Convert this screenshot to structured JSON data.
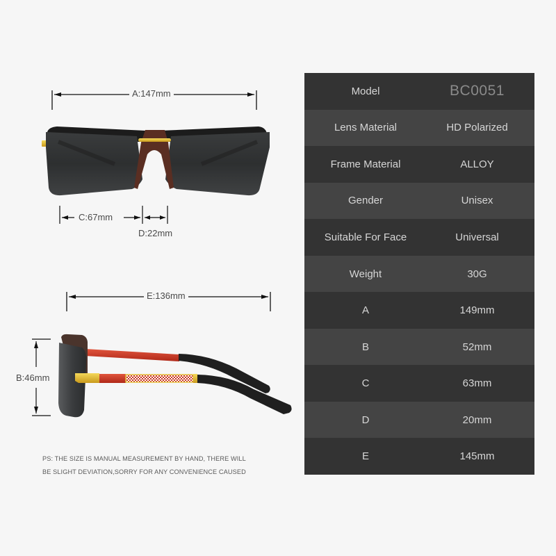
{
  "product": {
    "dimensions_front": {
      "a_label": "A:147mm",
      "c_label": "C:67mm",
      "d_label": "D:22mm"
    },
    "dimensions_side": {
      "e_label": "E:136mm",
      "b_label": "B:46mm"
    },
    "note_line1": "PS: THE SIZE IS MANUAL MEASUREMENT BY HAND, THERE WILL",
    "note_line2": "BE SLIGHT DEVIATION,SORRY FOR ANY CONVENIENCE CAUSED"
  },
  "colors": {
    "lens": "#2b2d2e",
    "bridge_brown": "#5a2e22",
    "gold": "#e8c23a",
    "temple_red": "#c8321f",
    "temple_tip": "#1f1f1f",
    "table_dark": "#333333",
    "table_light": "#444444"
  },
  "specs": [
    {
      "label": "Model",
      "value": "BC0051"
    },
    {
      "label": "Lens Material",
      "value": "HD Polarized"
    },
    {
      "label": "Frame Material",
      "value": "ALLOY"
    },
    {
      "label": "Gender",
      "value": "Unisex"
    },
    {
      "label": "Suitable For Face",
      "value": "Universal"
    },
    {
      "label": "Weight",
      "value": "30G"
    },
    {
      "label": "A",
      "value": "149mm"
    },
    {
      "label": "B",
      "value": "52mm"
    },
    {
      "label": "C",
      "value": "63mm"
    },
    {
      "label": "D",
      "value": "20mm"
    },
    {
      "label": "E",
      "value": "145mm"
    }
  ]
}
